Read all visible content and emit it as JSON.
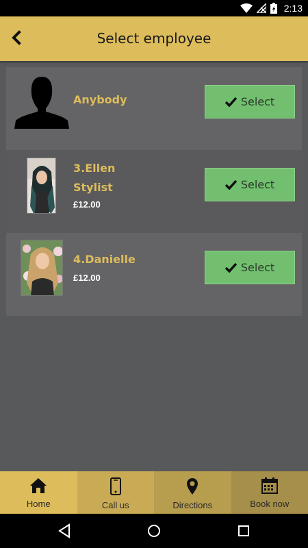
{
  "status_bar": {
    "time": "2:13",
    "icons": [
      "wifi-icon",
      "no-signal-icon",
      "battery-charging-icon"
    ]
  },
  "app_bar": {
    "title": "Select employee",
    "back_icon": "back-arrow-icon"
  },
  "employees": [
    {
      "name": "Anybody",
      "role": "",
      "price": "",
      "button_label": "Select",
      "avatar": "silhouette"
    },
    {
      "name": "3.Ellen",
      "role": "Stylist",
      "price": "£12.00",
      "button_label": "Select",
      "avatar": "photo"
    },
    {
      "name": "4.Danielle",
      "role": "",
      "price": "£12.00",
      "button_label": "Select",
      "avatar": "photo"
    }
  ],
  "bottom_nav": [
    {
      "label": "Home",
      "icon": "home-icon"
    },
    {
      "label": "Call us",
      "icon": "phone-icon"
    },
    {
      "label": "Directions",
      "icon": "map-pin-icon"
    },
    {
      "label": "Book now",
      "icon": "calendar-icon"
    }
  ],
  "system_nav": [
    "back-triangle-icon",
    "home-circle-icon",
    "recents-square-icon"
  ],
  "colors": {
    "accent": "#ddbc5b",
    "select_button": "#72bf6f",
    "background": "#58595b",
    "row_light": "#646466",
    "row_dark": "#5a5a5c"
  }
}
